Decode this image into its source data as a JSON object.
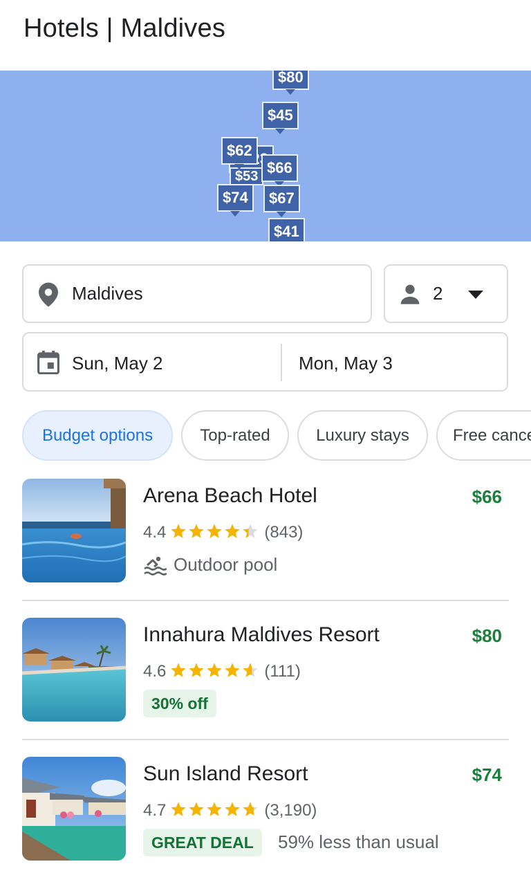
{
  "page": {
    "title": "Hotels | Maldives"
  },
  "map": {
    "pins": [
      "$80",
      "$123",
      "$53",
      "$45",
      "$62",
      "$66",
      "$74",
      "$67",
      "$41"
    ]
  },
  "search": {
    "location": "Maldives",
    "guests": "2",
    "check_in": "Sun, May 2",
    "check_out": "Mon, May 3"
  },
  "filters": [
    "Budget options",
    "Top-rated",
    "Luxury stays",
    "Free cancellation"
  ],
  "hotels": [
    {
      "name": "Arena Beach Hotel",
      "price": "$66",
      "rating": "4.4",
      "stars": 4.4,
      "reviews": "(843)",
      "amenity": "Outdoor pool"
    },
    {
      "name": "Innahura Maldives Resort",
      "price": "$80",
      "rating": "4.6",
      "stars": 4.6,
      "reviews": "(111)",
      "badge": "30% off"
    },
    {
      "name": "Sun Island Resort",
      "price": "$74",
      "rating": "4.7",
      "stars": 4.7,
      "reviews": "(3,190)",
      "badge": "GREAT DEAL",
      "note": "59% less than usual"
    }
  ],
  "colors": {
    "map": "#8fb0ee",
    "pin": "#3f63a6",
    "price": "#188038",
    "active_chip": "#1a73e8",
    "star": "#f4b400"
  }
}
